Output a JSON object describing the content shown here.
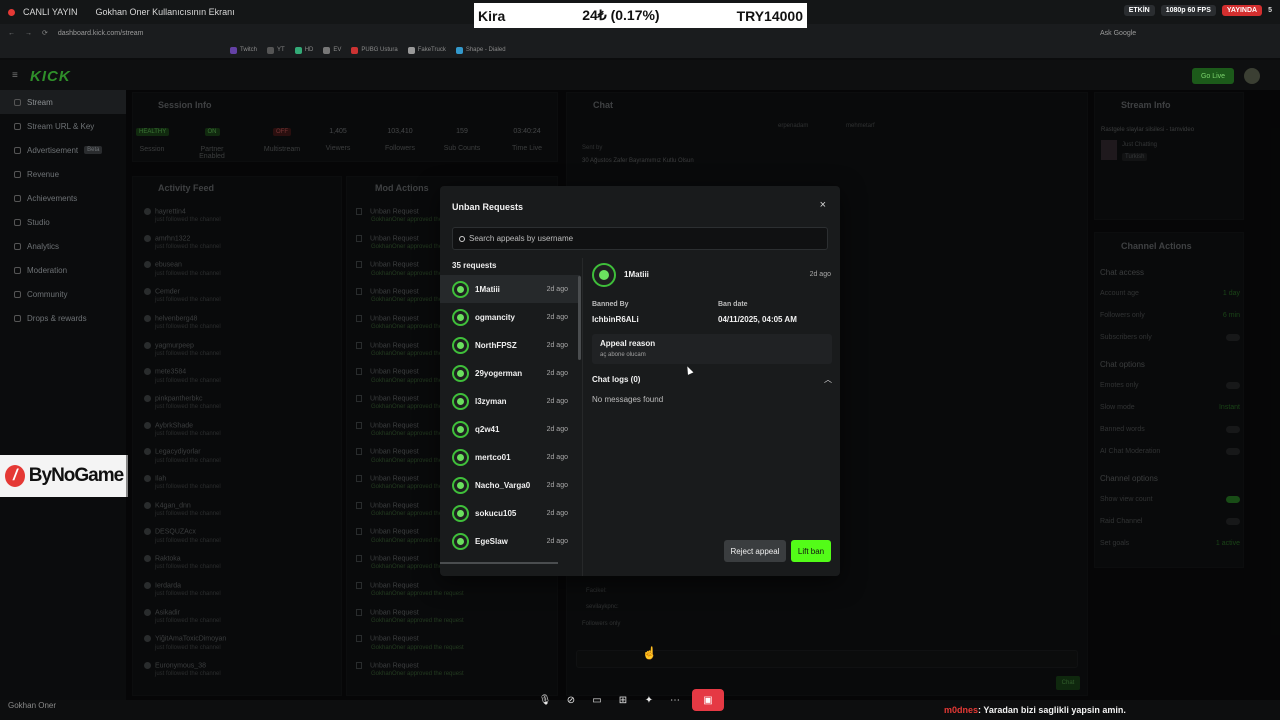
{
  "share_bar": {
    "live_label": "CANLI YAYIN",
    "screen_title": "Gokhan Oner Kullanıcısının Ekranı",
    "badges": [
      "ETKİN",
      "1080p 60 FPS",
      "YAYINDA"
    ],
    "viewers": "5"
  },
  "ticker": {
    "name": "Kira",
    "change": "24₺ (0.17%)",
    "price": "TRY14000"
  },
  "browser": {
    "url": "dashboard.kick.com/stream",
    "search_engine": "Ask Google",
    "bookmarks": [
      "Twitch",
      "YT",
      "HD",
      "EV",
      "PUBG Ustura",
      "FakeTruck",
      "Shape - Dialed"
    ]
  },
  "app": {
    "logo": "KICK",
    "go_live": "Go Live"
  },
  "sidebar": {
    "items": [
      {
        "label": "Stream"
      },
      {
        "label": "Stream URL & Key"
      },
      {
        "label": "Advertisement",
        "badge": "Beta"
      },
      {
        "label": "Revenue"
      },
      {
        "label": "Achievements"
      },
      {
        "label": "Studio"
      },
      {
        "label": "Analytics"
      },
      {
        "label": "Moderation"
      },
      {
        "label": "Community"
      },
      {
        "label": "Drops & rewards"
      }
    ]
  },
  "sponsor": {
    "name": "ByNoGame"
  },
  "session": {
    "title": "Session Info",
    "stats": [
      {
        "value": "HEALTHY",
        "label": "Session"
      },
      {
        "value": "ON",
        "label": "Partner Enabled"
      },
      {
        "value": "OFF",
        "label": "Multistream"
      },
      {
        "value": "1,405",
        "label": "Viewers"
      },
      {
        "value": "103,410",
        "label": "Followers"
      },
      {
        "value": "159",
        "label": "Sub Counts"
      },
      {
        "value": "03:40:24",
        "label": "Time Live"
      }
    ]
  },
  "activity": {
    "title": "Activity Feed",
    "sub": "just followed the channel",
    "users": [
      "hayrettin4",
      "amrhn1322",
      "ebusean",
      "Cemder",
      "helvenberg48",
      "yagmurpeep",
      "mete3584",
      "pinkpantherbkc",
      "AybrkShade",
      "Legacydiyorlar",
      "Ilah",
      "K4gan_dnn",
      "DESQUZAcx",
      "Raktoka",
      "Ierdarda",
      "Asikadir",
      "YiğitAmaToxicDimoyan",
      "Euronymous_38"
    ]
  },
  "mod_actions": {
    "title": "Mod Actions",
    "row_title": "Unban Request",
    "row_sub": "GokhanOner approved the request",
    "rows": 18
  },
  "chat": {
    "title": "Chat",
    "pinned": "30 Ağustos Zafer Bayramımız Kutlu Olsun",
    "viewer_a": "erpenadam",
    "viewer_b": "mehmetarf",
    "sent_by": "Sent by",
    "lower_lines": [
      "Facikel:",
      "sevilaykpnc:",
      "Followers only"
    ],
    "send": "Chat"
  },
  "stream_info": {
    "title": "Stream Info",
    "stream_title": "Rastgele slaylar silsilesi - tamvideo",
    "category": "Just Chatting",
    "tag": "Turkish"
  },
  "channel_actions": {
    "title": "Channel Actions",
    "sections": [
      {
        "head": "Chat access",
        "rows": [
          [
            "Account age",
            "1 day"
          ],
          [
            "Followers only",
            "6 min"
          ],
          [
            "Subscribers only",
            ""
          ]
        ]
      },
      {
        "head": "Chat options",
        "rows": [
          [
            "Emotes only",
            ""
          ],
          [
            "Slow mode",
            "Instant"
          ],
          [
            "Banned words",
            ""
          ],
          [
            "AI Chat Moderation",
            ""
          ]
        ]
      },
      {
        "head": "Channel options",
        "rows": [
          [
            "Show view count",
            ""
          ],
          [
            "Raid Channel",
            ""
          ],
          [
            "Set goals",
            "1 active"
          ]
        ]
      }
    ]
  },
  "modal": {
    "title": "Unban Requests",
    "close": "×",
    "search_placeholder": "Search appeals by username",
    "count_label": "35 requests",
    "requests": [
      {
        "name": "1Matiii",
        "time": "2d ago"
      },
      {
        "name": "ogmancity",
        "time": "2d ago"
      },
      {
        "name": "NorthFPSZ",
        "time": "2d ago"
      },
      {
        "name": "29yogerman",
        "time": "2d ago"
      },
      {
        "name": "l3zyman",
        "time": "2d ago"
      },
      {
        "name": "q2w41",
        "time": "2d ago"
      },
      {
        "name": "mertco01",
        "time": "2d ago"
      },
      {
        "name": "Nacho_Varga0",
        "time": "2d ago"
      },
      {
        "name": "sokucu105",
        "time": "2d ago"
      },
      {
        "name": "EgeSlaw",
        "time": "2d ago"
      }
    ],
    "detail": {
      "name": "1Matiii",
      "time": "2d ago",
      "banned_by_label": "Banned By",
      "banned_by": "IchbinR6ALi",
      "ban_date_label": "Ban date",
      "ban_date": "04/11/2025, 04:05 AM",
      "appeal_label": "Appeal reason",
      "appeal_text": "aç abone olucam",
      "logs_label": "Chat logs (0)",
      "no_messages": "No messages found"
    },
    "reject_label": "Reject appeal",
    "lift_label": "Lift ban"
  },
  "bottom": {
    "user": "Gokhan Oner",
    "chat_nick": "m0dnes",
    "chat_msg": ": Yaradan bizi saglikli yapsin amin."
  },
  "colors": {
    "kick_green": "#53fc18",
    "live_red": "#e53935",
    "panel_bg": "#121314",
    "modal_bg": "#191b1c"
  }
}
